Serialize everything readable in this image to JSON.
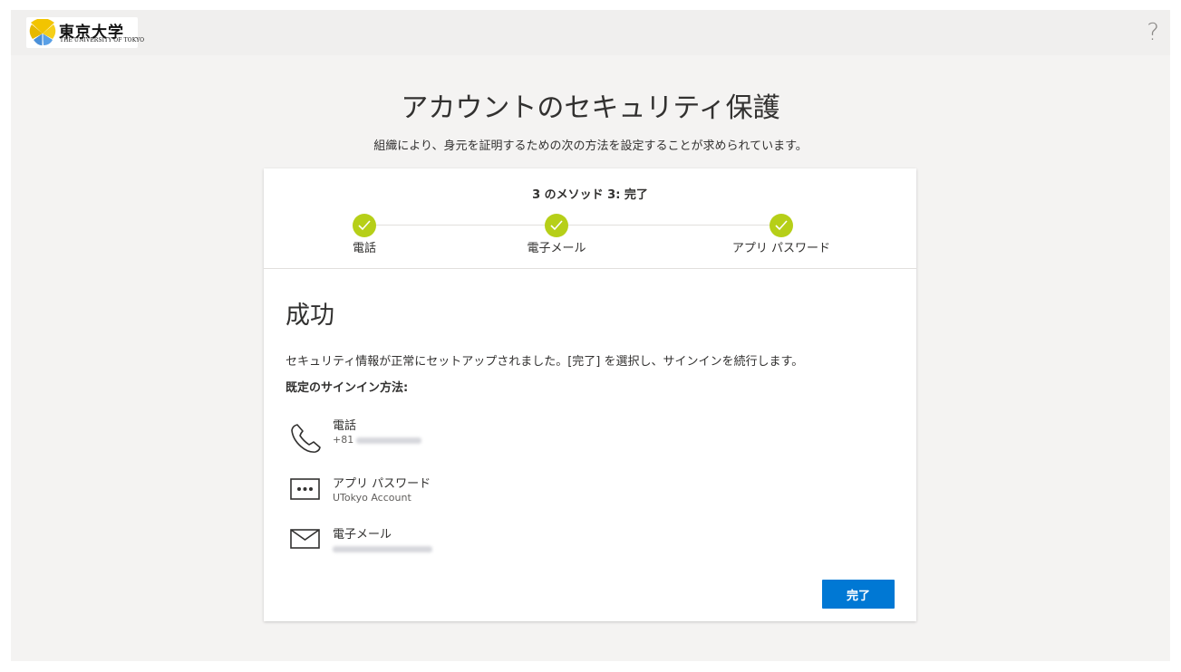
{
  "header": {
    "logo_kanji": "東京大学",
    "logo_english": "THE UNIVERSITY OF TOKYO",
    "help_icon": "?"
  },
  "title": "アカウントのセキュリティ保護",
  "subtitle": "組織により、身元を証明するための次の方法を設定することが求められています。",
  "wizard": {
    "step_count": "3 のメソッド 3: 完了",
    "steps": [
      {
        "label": "電話",
        "status": "complete"
      },
      {
        "label": "電子メール",
        "status": "complete"
      },
      {
        "label": "アプリ パスワード",
        "status": "complete"
      }
    ]
  },
  "result": {
    "heading": "成功",
    "message": "セキュリティ情報が正常にセットアップされました。[完了] を選択し、サインインを続行します。",
    "default_label": "既定のサインイン方法:"
  },
  "methods": [
    {
      "icon": "phone-icon",
      "name": "電話",
      "detail": "+81",
      "detail_redacted": true
    },
    {
      "icon": "password-dots-icon",
      "name": "アプリ パスワード",
      "detail": "UTokyo Account",
      "detail_redacted": false
    },
    {
      "icon": "mail-icon",
      "name": "電子メール",
      "detail": "",
      "detail_redacted": true
    }
  ],
  "done_button": "完了",
  "colors": {
    "accent": "#0078d4",
    "step_complete": "#b6cf18",
    "page_bg": "#f4f3f2"
  }
}
